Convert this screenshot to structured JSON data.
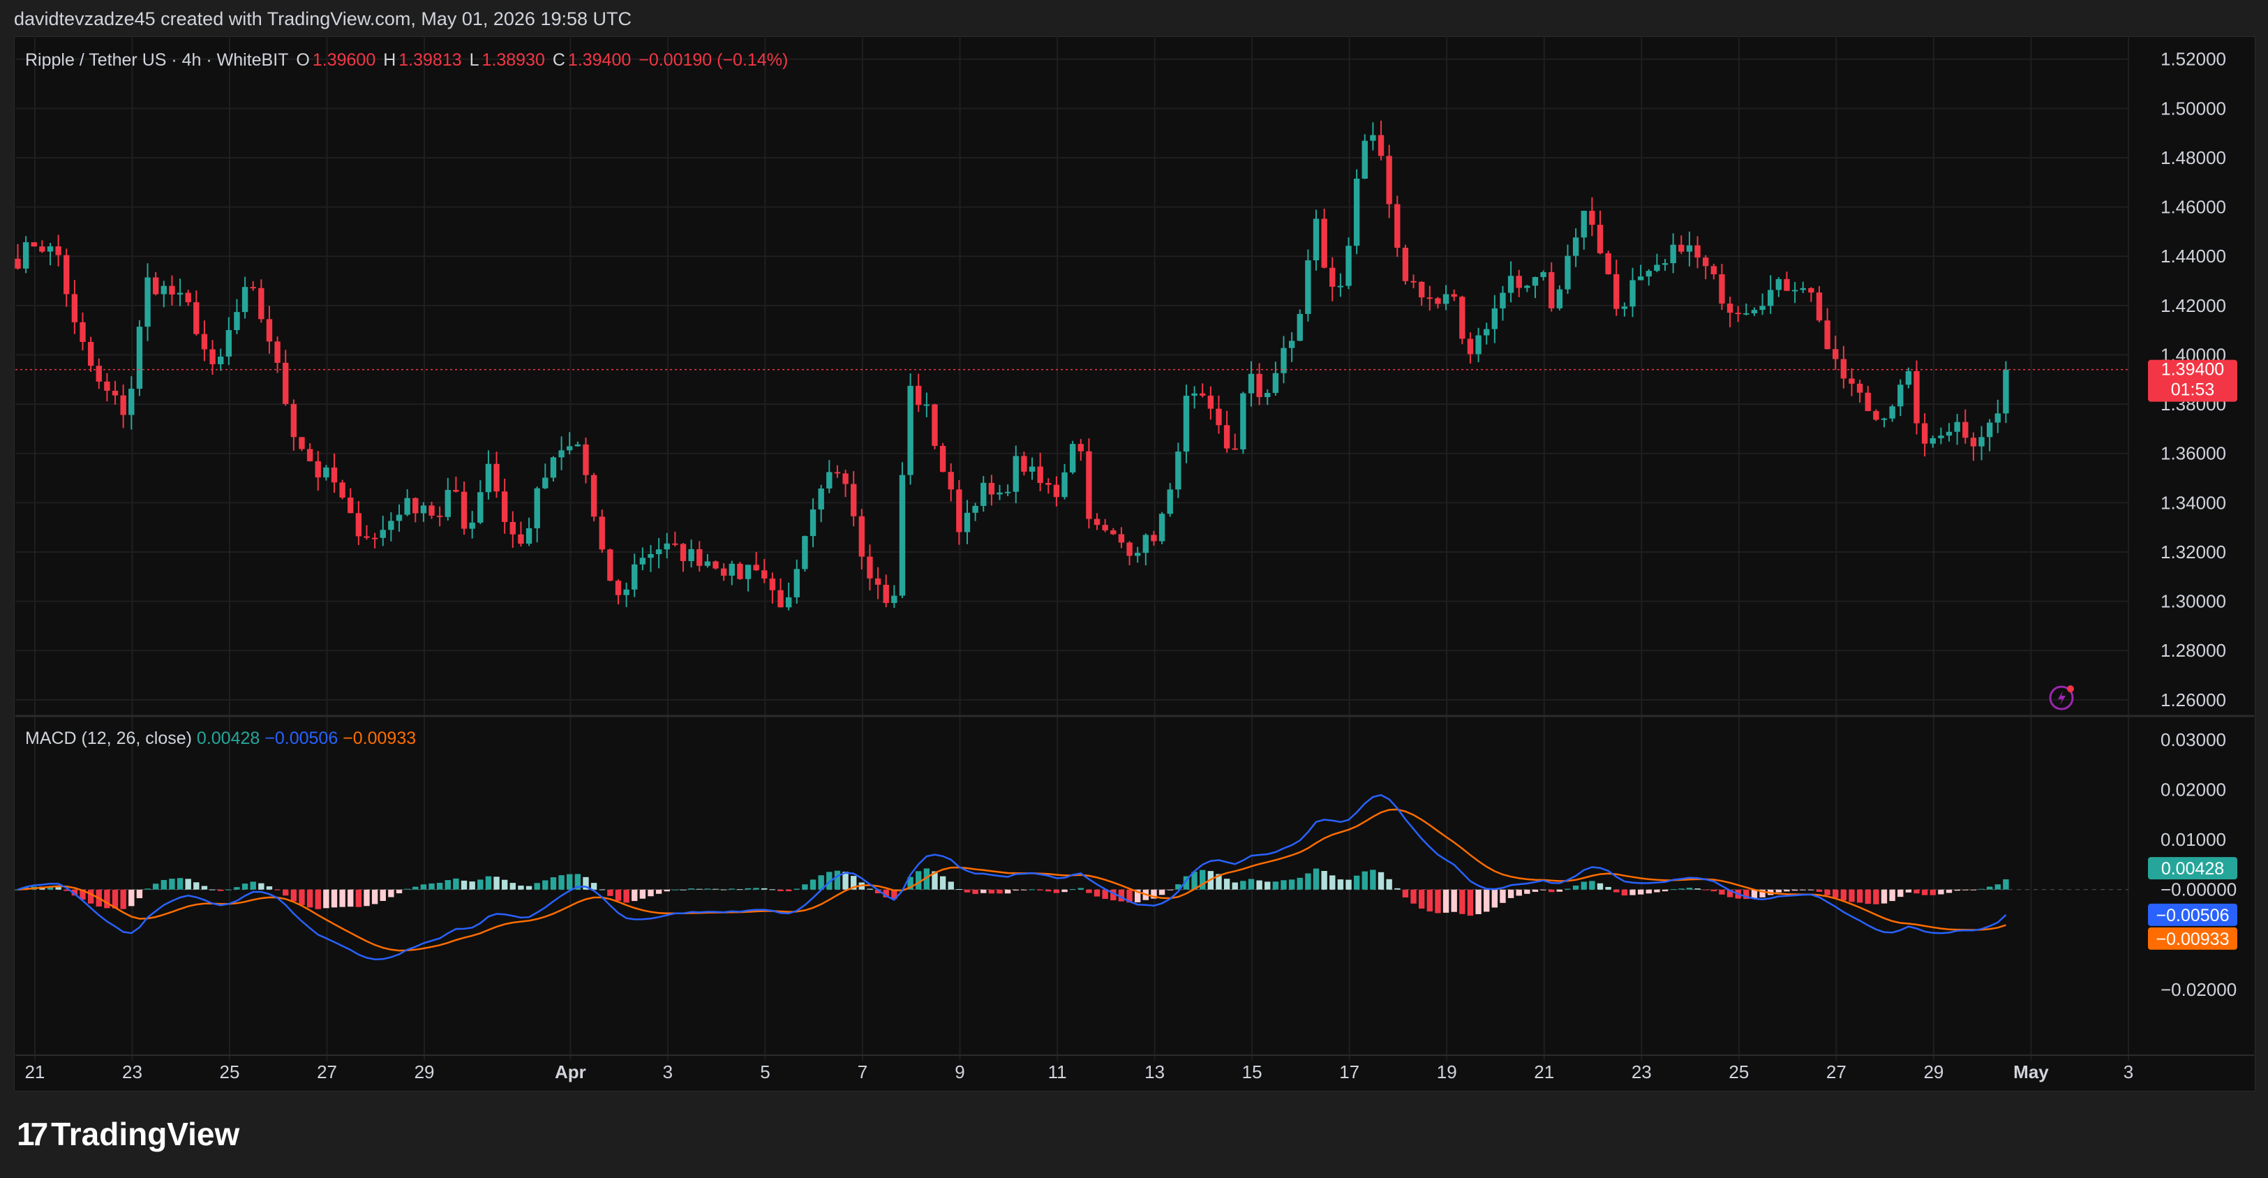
{
  "header": {
    "attribution": "davidtevzadze45 created with TradingView.com, May 01, 2026 19:58 UTC"
  },
  "legend": {
    "symbol": "Ripple / Tether US · 4h · WhiteBIT",
    "o_label": "O",
    "o_value": "1.39600",
    "h_label": "H",
    "h_value": "1.39813",
    "l_label": "L",
    "l_value": "1.38930",
    "c_label": "C",
    "c_value": "1.39400",
    "change": "−0.00190 (−0.14%)"
  },
  "macd_legend": {
    "name": "MACD (12, 26, close)",
    "hist": "0.00428",
    "macd": "−0.00506",
    "signal": "−0.00933"
  },
  "logo": {
    "text": "TradingView"
  },
  "colors": {
    "up": "#26a69a",
    "down": "#f23645",
    "up_light": "#b2dfdb",
    "down_light": "#ffcdd2",
    "macd_line": "#2962ff",
    "signal_line": "#ff6d00",
    "grid": "#1f1f1f",
    "bg": "#0f0f0f",
    "frame_bg": "#1e1e1e"
  },
  "icons": {
    "alert": "lightning-icon"
  },
  "chart_data": {
    "type": "candlestick",
    "timeframe": "4h",
    "symbol": "XRP/USDT",
    "price_axis": {
      "ticks": [
        "1.52000",
        "1.50000",
        "1.48000",
        "1.46000",
        "1.44000",
        "1.42000",
        "1.40000",
        "1.38000",
        "1.36000",
        "1.34000",
        "1.32000",
        "1.30000",
        "1.28000",
        "1.26000"
      ],
      "ylim": [
        1.254,
        1.527
      ]
    },
    "current_price": {
      "value": 1.394,
      "label": "1.39400",
      "countdown": "01:53"
    },
    "x_ticks": [
      {
        "label": "21",
        "day": 21
      },
      {
        "label": "23",
        "day": 23
      },
      {
        "label": "25",
        "day": 25
      },
      {
        "label": "27",
        "day": 27
      },
      {
        "label": "29",
        "day": 29
      },
      {
        "label": "Apr",
        "day": 32,
        "bold": true
      },
      {
        "label": "3",
        "day": 34
      },
      {
        "label": "5",
        "day": 36
      },
      {
        "label": "7",
        "day": 38
      },
      {
        "label": "9",
        "day": 40
      },
      {
        "label": "11",
        "day": 42
      },
      {
        "label": "13",
        "day": 44
      },
      {
        "label": "15",
        "day": 46
      },
      {
        "label": "17",
        "day": 48
      },
      {
        "label": "19",
        "day": 50
      },
      {
        "label": "21",
        "day": 52
      },
      {
        "label": "23",
        "day": 54
      },
      {
        "label": "25",
        "day": 56
      },
      {
        "label": "27",
        "day": 58
      },
      {
        "label": "29",
        "day": 60
      },
      {
        "label": "May",
        "day": 62,
        "bold": true
      },
      {
        "label": "3",
        "day": 64
      }
    ],
    "x_domain_days": [
      20.6,
      64.0
    ],
    "close_anchors": [
      [
        20.6,
        1.438
      ],
      [
        21.0,
        1.446
      ],
      [
        21.5,
        1.44
      ],
      [
        21.8,
        1.412
      ],
      [
        22.3,
        1.388
      ],
      [
        22.9,
        1.376
      ],
      [
        23.3,
        1.43
      ],
      [
        23.8,
        1.425
      ],
      [
        24.2,
        1.418
      ],
      [
        24.7,
        1.39
      ],
      [
        25.0,
        1.41
      ],
      [
        25.4,
        1.428
      ],
      [
        25.8,
        1.408
      ],
      [
        26.3,
        1.37
      ],
      [
        26.8,
        1.352
      ],
      [
        27.1,
        1.35
      ],
      [
        27.5,
        1.332
      ],
      [
        28.0,
        1.325
      ],
      [
        28.5,
        1.338
      ],
      [
        29.0,
        1.34
      ],
      [
        29.3,
        1.332
      ],
      [
        29.6,
        1.348
      ],
      [
        29.9,
        1.326
      ],
      [
        30.3,
        1.358
      ],
      [
        30.7,
        1.33
      ],
      [
        31.0,
        1.322
      ],
      [
        31.4,
        1.348
      ],
      [
        31.8,
        1.36
      ],
      [
        32.2,
        1.364
      ],
      [
        32.6,
        1.32
      ],
      [
        33.0,
        1.3
      ],
      [
        33.4,
        1.318
      ],
      [
        33.8,
        1.322
      ],
      [
        34.2,
        1.32
      ],
      [
        34.6,
        1.318
      ],
      [
        35.0,
        1.316
      ],
      [
        35.4,
        1.31
      ],
      [
        35.8,
        1.316
      ],
      [
        36.2,
        1.302
      ],
      [
        36.5,
        1.298
      ],
      [
        36.9,
        1.33
      ],
      [
        37.3,
        1.35
      ],
      [
        37.6,
        1.356
      ],
      [
        38.0,
        1.32
      ],
      [
        38.4,
        1.302
      ],
      [
        38.7,
        1.3
      ],
      [
        38.9,
        1.388
      ],
      [
        39.3,
        1.378
      ],
      [
        39.7,
        1.35
      ],
      [
        40.0,
        1.33
      ],
      [
        40.4,
        1.346
      ],
      [
        40.8,
        1.34
      ],
      [
        41.2,
        1.358
      ],
      [
        41.6,
        1.348
      ],
      [
        42.0,
        1.344
      ],
      [
        42.4,
        1.372
      ],
      [
        42.7,
        1.33
      ],
      [
        43.1,
        1.326
      ],
      [
        43.5,
        1.322
      ],
      [
        43.9,
        1.324
      ],
      [
        44.3,
        1.34
      ],
      [
        44.6,
        1.38
      ],
      [
        44.9,
        1.382
      ],
      [
        45.3,
        1.37
      ],
      [
        45.6,
        1.358
      ],
      [
        45.9,
        1.392
      ],
      [
        46.2,
        1.382
      ],
      [
        46.6,
        1.398
      ],
      [
        46.9,
        1.408
      ],
      [
        47.3,
        1.455
      ],
      [
        47.6,
        1.425
      ],
      [
        47.9,
        1.43
      ],
      [
        48.1,
        1.47
      ],
      [
        48.4,
        1.488
      ],
      [
        48.7,
        1.478
      ],
      [
        48.9,
        1.444
      ],
      [
        49.2,
        1.43
      ],
      [
        49.5,
        1.426
      ],
      [
        49.8,
        1.42
      ],
      [
        50.1,
        1.424
      ],
      [
        50.4,
        1.4
      ],
      [
        50.7,
        1.41
      ],
      [
        51.0,
        1.418
      ],
      [
        51.3,
        1.432
      ],
      [
        51.6,
        1.424
      ],
      [
        51.9,
        1.436
      ],
      [
        52.2,
        1.42
      ],
      [
        52.6,
        1.448
      ],
      [
        52.9,
        1.46
      ],
      [
        53.2,
        1.44
      ],
      [
        53.5,
        1.418
      ],
      [
        53.8,
        1.428
      ],
      [
        54.1,
        1.43
      ],
      [
        54.5,
        1.436
      ],
      [
        54.8,
        1.446
      ],
      [
        55.1,
        1.44
      ],
      [
        55.4,
        1.432
      ],
      [
        55.8,
        1.42
      ],
      [
        56.2,
        1.42
      ],
      [
        56.5,
        1.424
      ],
      [
        56.9,
        1.428
      ],
      [
        57.3,
        1.43
      ],
      [
        57.6,
        1.42
      ],
      [
        57.9,
        1.396
      ],
      [
        58.2,
        1.39
      ],
      [
        58.5,
        1.382
      ],
      [
        58.8,
        1.374
      ],
      [
        59.1,
        1.38
      ],
      [
        59.5,
        1.39
      ],
      [
        59.8,
        1.36
      ],
      [
        60.1,
        1.37
      ],
      [
        60.5,
        1.372
      ],
      [
        60.8,
        1.366
      ],
      [
        61.1,
        1.37
      ],
      [
        61.4,
        1.378
      ],
      [
        61.6,
        1.394
      ]
    ],
    "macd": {
      "params": "12, 26, close",
      "ticks": [
        "0.03000",
        "0.02000",
        "0.01000",
        "−0.00000",
        "−0.02000"
      ],
      "ylim": [
        -0.0315,
        0.0345
      ],
      "current": {
        "histogram": 0.00428,
        "macd": -0.00506,
        "signal": -0.00933
      },
      "labels": {
        "histogram": "0.00428",
        "macd": "−0.00506",
        "signal": "−0.00933"
      }
    }
  }
}
